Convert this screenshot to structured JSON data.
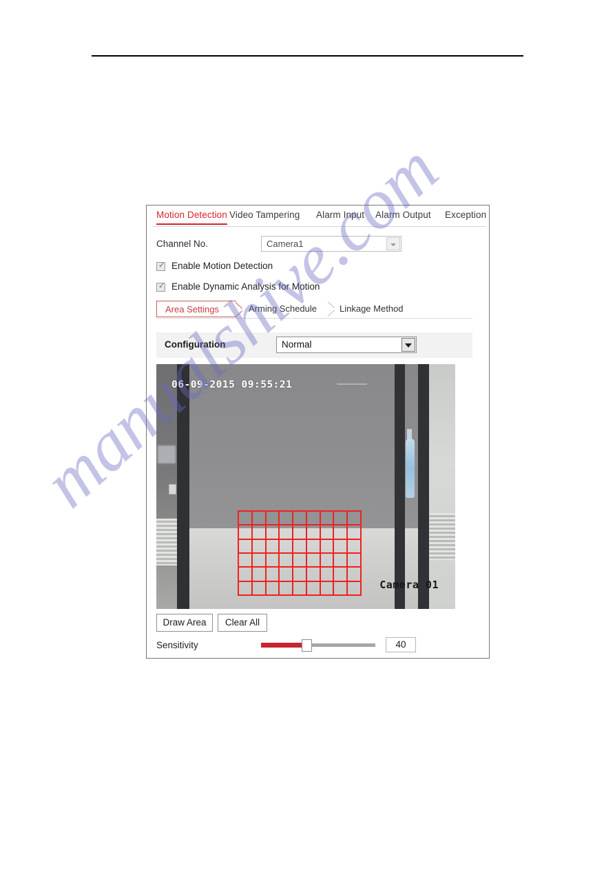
{
  "page": {
    "watermark": "manualshive.com"
  },
  "tabs": [
    {
      "label": "Motion Detection",
      "active": true
    },
    {
      "label": "Video Tampering",
      "active": false
    },
    {
      "label": "Alarm Input",
      "active": false
    },
    {
      "label": "Alarm Output",
      "active": false
    },
    {
      "label": "Exception",
      "active": false
    }
  ],
  "channel": {
    "label": "Channel No.",
    "value": "Camera1",
    "arrow_icon": "chevron-down-icon"
  },
  "checkboxes": [
    {
      "label": "Enable Motion Detection",
      "checked": true,
      "mark": "✓"
    },
    {
      "label": "Enable Dynamic Analysis for Motion",
      "checked": true,
      "mark": "✓"
    }
  ],
  "subtabs": [
    {
      "label": "Area Settings",
      "active": true
    },
    {
      "label": "Arming Schedule",
      "active": false
    },
    {
      "label": "Linkage Method",
      "active": false
    }
  ],
  "configuration": {
    "label": "Configuration",
    "value": "Normal",
    "options": [
      "Normal"
    ],
    "arrow_icon": "chevron-down-icon"
  },
  "video": {
    "timestamp": "06-09-2015 09:55:21",
    "camera_name": "Camera 01",
    "grid": {
      "columns": 9,
      "rows": 6,
      "color": "#f02020"
    }
  },
  "buttons": {
    "draw_area": "Draw Area",
    "clear_all": "Clear All"
  },
  "sensitivity": {
    "label": "Sensitivity",
    "value": "40",
    "min": 0,
    "max": 100,
    "fill_color": "#c8262e",
    "track_color": "#a6a6a6"
  },
  "colors": {
    "accent_red": "#d8232a",
    "grid_red": "#f02020",
    "band_gray": "#f2f2f2"
  }
}
